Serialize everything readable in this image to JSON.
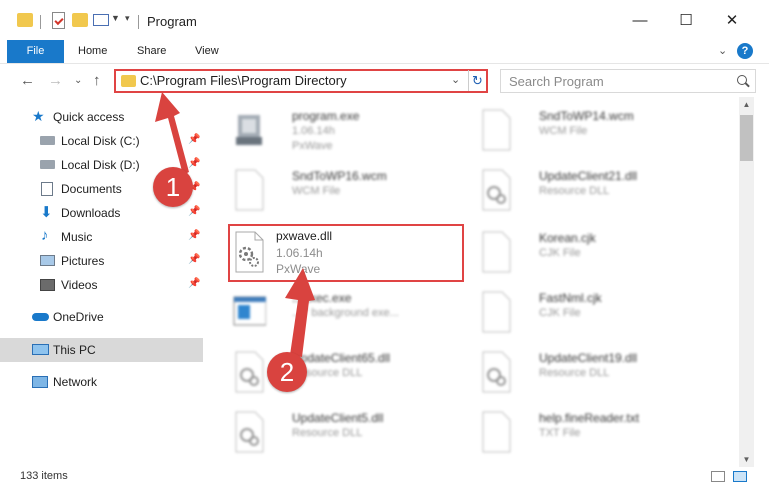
{
  "window": {
    "title": "Program",
    "controls": {
      "minimize": "—",
      "maximize": "☐",
      "close": "✕"
    }
  },
  "ribbon": {
    "tabs": [
      "File",
      "Home",
      "Share",
      "View"
    ],
    "help": "?"
  },
  "nav": {
    "address": "C:\\Program Files\\Program Directory",
    "search_placeholder": "Search Program"
  },
  "sidebar": {
    "items": [
      {
        "label": "Quick access",
        "icon": "star-icon",
        "pinned": false
      },
      {
        "label": "Local Disk (C:)",
        "icon": "drive-icon",
        "pinned": true
      },
      {
        "label": "Local Disk (D:)",
        "icon": "drive-icon",
        "pinned": true
      },
      {
        "label": "Documents",
        "icon": "documents-icon",
        "pinned": true
      },
      {
        "label": "Downloads",
        "icon": "downloads-icon",
        "pinned": true
      },
      {
        "label": "Music",
        "icon": "music-icon",
        "pinned": true
      },
      {
        "label": "Pictures",
        "icon": "pictures-icon",
        "pinned": true
      },
      {
        "label": "Videos",
        "icon": "videos-icon",
        "pinned": true
      },
      {
        "label": "OneDrive",
        "icon": "onedrive-icon",
        "pinned": false
      },
      {
        "label": "This PC",
        "icon": "computer-icon",
        "pinned": false,
        "selected": true
      },
      {
        "label": "Network",
        "icon": "network-icon",
        "pinned": false
      }
    ]
  },
  "files": [
    {
      "name": "program.exe",
      "line2": "1.06.14h",
      "line3": "PxWave",
      "icon": "exe-icon"
    },
    {
      "name": "SndToWP14.wcm",
      "line2": "WCM File",
      "line3": "",
      "icon": "file-icon"
    },
    {
      "name": "SndToWP16.wcm",
      "line2": "WCM File",
      "line3": "",
      "icon": "file-icon"
    },
    {
      "name": "UpdateClient21.dll",
      "line2": "Resource DLL",
      "line3": "",
      "icon": "dll-icon"
    },
    {
      "name": "pxwave.dll",
      "line2": "1.06.14h",
      "line3": "PxWave",
      "icon": "dll-icon"
    },
    {
      "name": "Korean.cjk",
      "line2": "CJK File",
      "line3": "",
      "icon": "file-icon"
    },
    {
      "name": "...Exec.exe",
      "line2": "...Y background exe...",
      "line3": "",
      "icon": "app-window-icon"
    },
    {
      "name": "FastNml.cjk",
      "line2": "CJK File",
      "line3": "",
      "icon": "file-icon"
    },
    {
      "name": "UpdateClient65.dll",
      "line2": "Resource DLL",
      "line3": "",
      "icon": "dll-icon"
    },
    {
      "name": "UpdateClient19.dll",
      "line2": "Resource DLL",
      "line3": "",
      "icon": "dll-icon"
    },
    {
      "name": "UpdateClient5.dll",
      "line2": "Resource DLL",
      "line3": "",
      "icon": "dll-icon"
    },
    {
      "name": "help.fineReader.txt",
      "line2": "TXT File",
      "line3": "",
      "icon": "file-icon"
    }
  ],
  "status": {
    "count": "133 items"
  },
  "annotations": {
    "step1": "1",
    "step2": "2"
  },
  "colors": {
    "accent": "#1979ca",
    "annotation": "#d9433f",
    "selected": "#d9d9d9"
  }
}
